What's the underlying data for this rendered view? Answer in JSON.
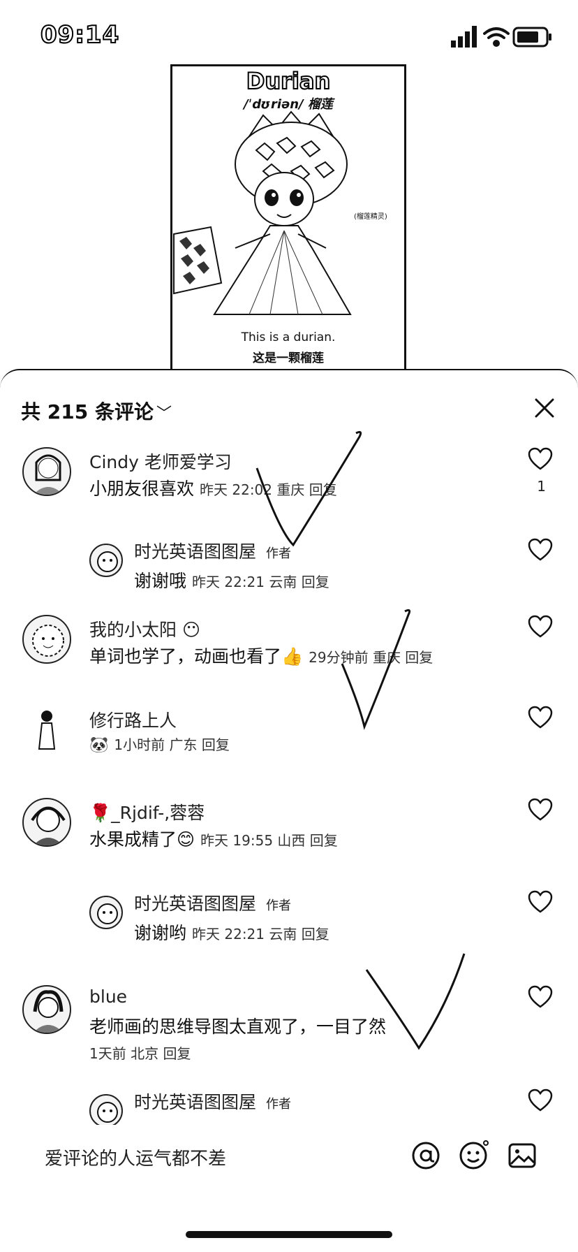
{
  "status_bar": {
    "time": "09:14"
  },
  "video": {
    "title": "Durian",
    "phonetic": "/ˈdʊriən/ 榴莲",
    "side_text": "(榴莲精灵)",
    "caption_en": "This is a durian.",
    "caption_cn": "这是一颗榴莲"
  },
  "comments_panel": {
    "header": "共 215 条评论",
    "comments": [
      {
        "user": "Cindy 老师爱学习",
        "text": "小朋友很喜欢",
        "meta": "昨天 22:02 重庆 回复",
        "likes": "1"
      },
      {
        "user": "时光英语图图屋",
        "tag": "作者",
        "text": "谢谢哦",
        "meta": "昨天 22:21 云南 回复"
      },
      {
        "user": "我的小太阳 😶",
        "text": "单词也学了，动画也看了👍",
        "meta": "29分钟前 重庆 回复"
      },
      {
        "user": "修行路上人",
        "text": "🐼",
        "meta": "1小时前 广东 回复"
      },
      {
        "user": "🌹_Rjdif-,蓉蓉",
        "text": "水果成精了😊",
        "meta": "昨天 19:55 山西 回复"
      },
      {
        "user": "时光英语图图屋",
        "tag": "作者",
        "text": "谢谢哟",
        "meta": "昨天 22:21 云南 回复"
      },
      {
        "user": "blue",
        "text": "老师画的思维导图太直观了，一目了然",
        "meta": "1天前 北京 回复"
      },
      {
        "user": "时光英语图图屋",
        "tag": "作者"
      }
    ]
  },
  "input_bar": {
    "placeholder": "爱评论的人运气都不差"
  }
}
